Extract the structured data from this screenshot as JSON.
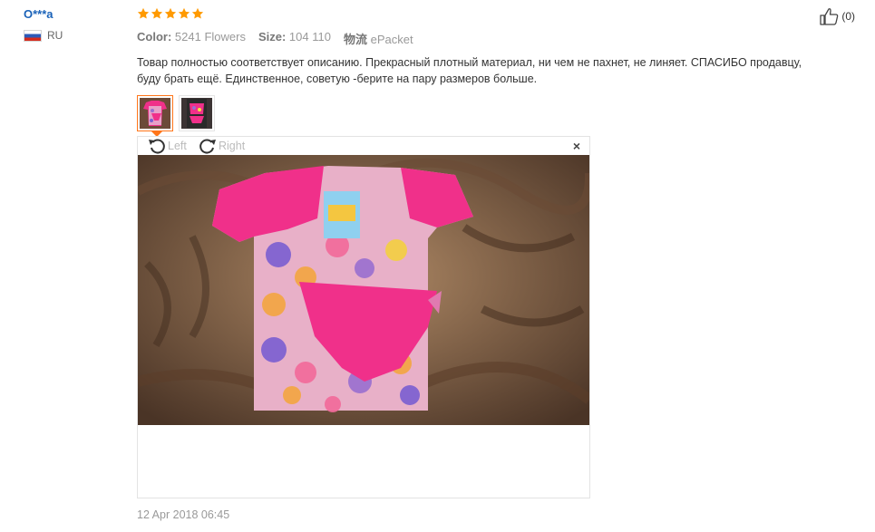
{
  "user": {
    "name": "O***a",
    "country": "RU"
  },
  "rating": {
    "stars": 5,
    "color": "#ff9a00"
  },
  "meta": {
    "color_label": "Color:",
    "color_value": "5241 Flowers",
    "size_label": "Size:",
    "size_value": "104 110",
    "shipping_label": "物流",
    "shipping_value": "ePacket"
  },
  "review_text": "Товар полностью соответствует описанию. Прекрасный плотный материал, ни чем не пахнет, не линяет. СПАСИБО продавцу, буду брать ещё. Единственное, советую -берите на пару размеров больше.",
  "viewer": {
    "rotate_left_label": "Left",
    "rotate_right_label": "Right",
    "close_glyph": "×"
  },
  "date": "12 Apr 2018 06:45",
  "helpful": {
    "count_label": "(0)"
  },
  "colors": {
    "accent": "#ff7519",
    "link": "#1a62b8",
    "pink": "#f0308a"
  }
}
